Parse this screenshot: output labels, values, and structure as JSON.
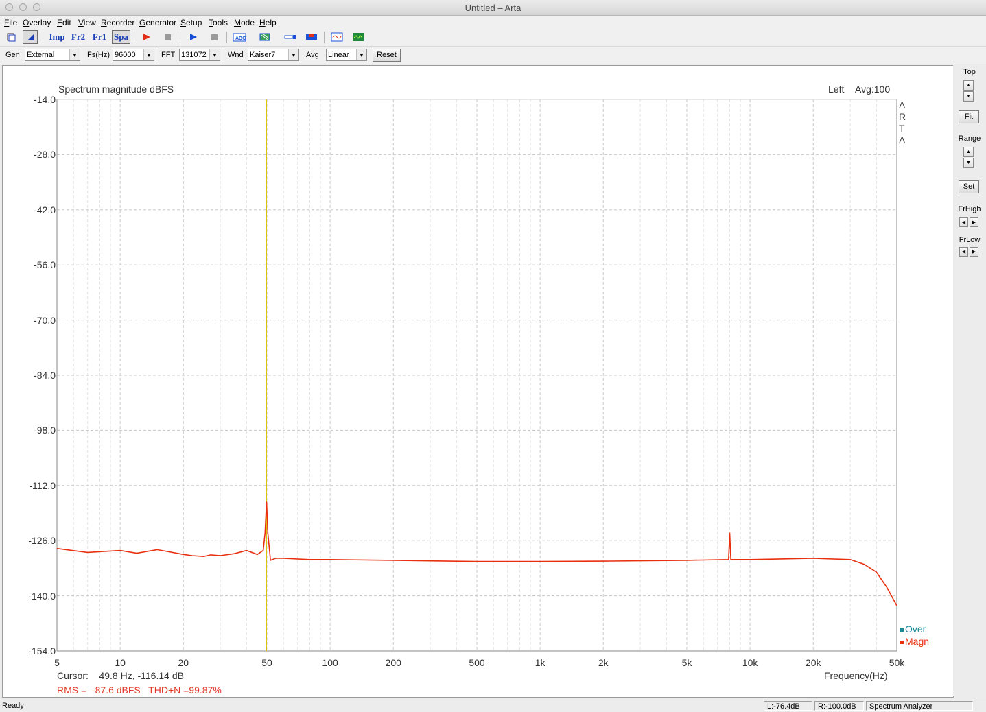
{
  "window": {
    "title": "Untitled – Arta"
  },
  "menu": [
    "File",
    "Overlay",
    "Edit",
    "View",
    "Recorder",
    "Generator",
    "Setup",
    "Tools",
    "Mode",
    "Help"
  ],
  "toolbar": {
    "imp": "Imp",
    "fr2": "Fr2",
    "fr1": "Fr1",
    "spa": "Spa"
  },
  "controls": {
    "gen_label": "Gen",
    "gen_value": "External",
    "fs_label": "Fs(Hz)",
    "fs_value": "96000",
    "fft_label": "FFT",
    "fft_value": "131072",
    "wnd_label": "Wnd",
    "wnd_value": "Kaiser7",
    "avg_label": "Avg",
    "avg_value": "Linear",
    "reset_label": "Reset"
  },
  "plot": {
    "title": "Spectrum magnitude dBFS",
    "channel": "Left",
    "avg": "Avg:100",
    "watermark": [
      "A",
      "R",
      "T",
      "A"
    ],
    "cursor": "Cursor:    49.8 Hz, -116.14 dB",
    "rms": "RMS =  -87.6 dBFS   THD+N =99.87%",
    "x_axis_label": "Frequency(Hz)",
    "legend": [
      {
        "name": "Over",
        "color": "#1a8a9a"
      },
      {
        "name": "Magn",
        "color": "#e8300f"
      }
    ]
  },
  "chart_data": {
    "type": "line",
    "xscale": "log",
    "xlim": [
      5,
      50000
    ],
    "ylim": [
      -154,
      -14
    ],
    "yticks": [
      "-14.0",
      "-28.0",
      "-42.0",
      "-56.0",
      "-70.0",
      "-84.0",
      "-98.0",
      "-112.0",
      "-126.0",
      "-140.0",
      "-154.0"
    ],
    "xticks": [
      "5",
      "10",
      "20",
      "50",
      "100",
      "200",
      "500",
      "1k",
      "2k",
      "5k",
      "10k",
      "20k",
      "50k"
    ],
    "cursor_hz": 49.8,
    "series": [
      {
        "name": "Magn",
        "color": "#e8300f",
        "x": [
          5,
          7,
          10,
          12,
          15,
          20,
          22,
          25,
          27,
          30,
          35,
          40,
          45,
          48,
          49,
          49.8,
          50.5,
          52,
          55,
          60,
          80,
          100,
          200,
          500,
          1000,
          2000,
          5000,
          7900,
          8000,
          8100,
          10000,
          20000,
          30000,
          35000,
          40000,
          45000,
          50000
        ],
        "y": [
          -128.0,
          -129.0,
          -128.5,
          -129.2,
          -128.3,
          -129.5,
          -129.8,
          -130.0,
          -129.6,
          -129.8,
          -129.3,
          -128.5,
          -129.5,
          -128.5,
          -124.0,
          -116.1,
          -124.0,
          -131.0,
          -130.5,
          -130.5,
          -130.8,
          -130.8,
          -131.0,
          -131.3,
          -131.3,
          -131.2,
          -131.0,
          -130.8,
          -124.0,
          -130.8,
          -130.8,
          -130.5,
          -130.8,
          -132.0,
          -134.0,
          -138.0,
          -142.5
        ]
      }
    ]
  }
}
